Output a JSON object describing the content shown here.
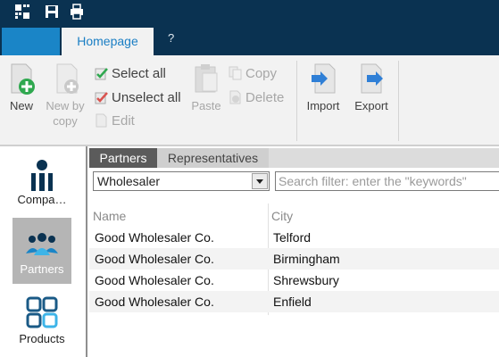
{
  "ribbon_tabs": {
    "home": "Homepage",
    "help": "?"
  },
  "ribbon": {
    "new": "New",
    "new_by_copy": "New by copy",
    "select_all": "Select all",
    "unselect_all": "Unselect all",
    "edit": "Edit",
    "paste": "Paste",
    "copy": "Copy",
    "delete": "Delete",
    "import": "Import",
    "export": "Export"
  },
  "nav": {
    "companies": "Compa…",
    "partners": "Partners",
    "products": "Products"
  },
  "content_tabs": [
    "Partners",
    "Representatives"
  ],
  "filter": {
    "selected": "Wholesaler",
    "search_placeholder": "Search filter: enter the \"keywords\""
  },
  "grid": {
    "columns": [
      "Name",
      "City"
    ],
    "rows": [
      [
        "Good Wholesaler Co.",
        "Telford"
      ],
      [
        "Good Wholesaler Co.",
        "Birmingham"
      ],
      [
        "Good Wholesaler Co.",
        "Shrewsbury"
      ],
      [
        "Good Wholesaler Co.",
        "Enfield"
      ]
    ]
  },
  "colors": {
    "titlebar": "#0a3251",
    "accent": "#1a85c7",
    "ribbon_bg": "#f2f2f2",
    "active_nav": "#b5b5b5",
    "active_tab": "#5b5b5b"
  }
}
